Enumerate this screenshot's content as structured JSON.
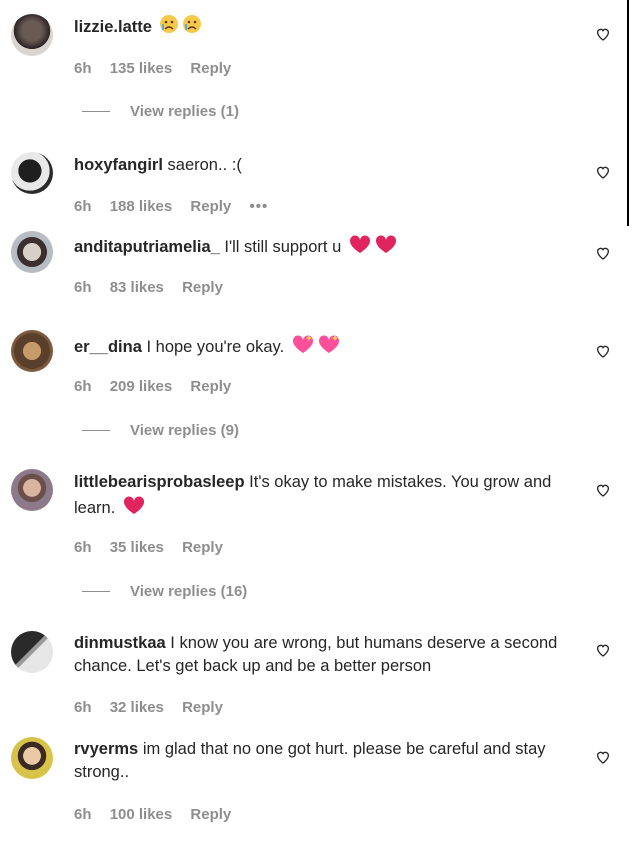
{
  "comments": [
    {
      "username": "lizzie.latte",
      "text": "",
      "emoji": "crying",
      "time": "6h",
      "likes": "135 likes",
      "reply": "Reply",
      "view_replies": "View replies (1)"
    },
    {
      "username": "hoxyfangirl",
      "text": "saeron.. :(",
      "time": "6h",
      "likes": "188 likes",
      "reply": "Reply",
      "more": "•••"
    },
    {
      "username": "anditaputriamelia_",
      "text": "I'll still support u",
      "emoji": "heart",
      "time": "6h",
      "likes": "83 likes",
      "reply": "Reply"
    },
    {
      "username": "er__dina",
      "text": "I hope you're okay.",
      "emoji": "sparkle-heart",
      "time": "6h",
      "likes": "209 likes",
      "reply": "Reply",
      "view_replies": "View replies (9)"
    },
    {
      "username": "littlebearisprobasleep",
      "text": "It's okay to make mistakes. You grow and learn.",
      "emoji": "heart",
      "time": "6h",
      "likes": "35 likes",
      "reply": "Reply",
      "view_replies": "View replies (16)"
    },
    {
      "username": "dinmustkaa",
      "text": "I know you are wrong, but humans deserve a second chance. Let's get back up and be a better person",
      "time": "6h",
      "likes": "32 likes",
      "reply": "Reply"
    },
    {
      "username": "rvyerms",
      "text": "im glad that no one got hurt. please be careful and stay strong..",
      "time": "6h",
      "likes": "100 likes",
      "reply": "Reply"
    }
  ],
  "colors": {
    "text": "#262626",
    "muted": "#8e8e8e",
    "heart_red": "#e0245e",
    "sparkle_pink": "#ff4f9a"
  }
}
